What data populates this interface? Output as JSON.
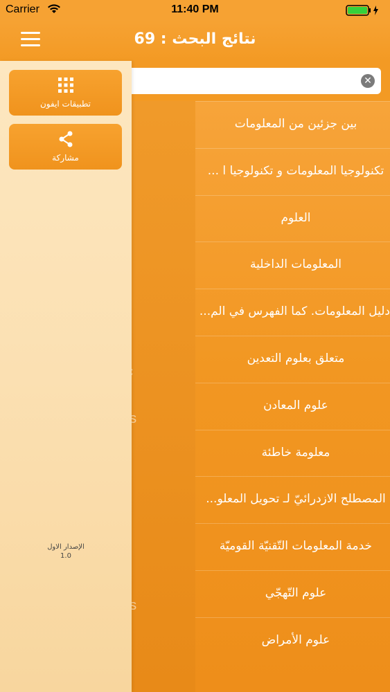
{
  "status_bar": {
    "carrier": "Carrier",
    "time": "11:40 PM"
  },
  "nav": {
    "title": "نتائج البحث : 69",
    "menu_icon": "hamburger-icon"
  },
  "search": {
    "value": "",
    "placeholder": ""
  },
  "results": [
    "بين جزئين من المعلومات",
    "تكنولوجيا المعلومات و تكنولوجيا ا ...",
    "العلوم",
    "المعلومات الداخلية",
    "دليل المعلومات. كما الفهرس في الم...",
    "متعلق بعلوم التعدين",
    "علوم المعادن",
    "معلومة خاطئة",
    "المصطلح الازدرائيّ لـ تحويل المعلو...",
    "خدمة المعلومات التّقنيّة القوميّة",
    "علوم التّهجّي",
    "علوم الأمراض"
  ],
  "ghost_text": [
    "c",
    "es",
    "es",
    "s"
  ],
  "drawer": {
    "apps_label": "تطبيقات ايفون",
    "share_label": "مشاركة",
    "version_label": "الإصدار الاول",
    "version_number": "1.0"
  },
  "colors": {
    "accent": "#f39a24",
    "drawer_bg": "#fde7c0"
  }
}
